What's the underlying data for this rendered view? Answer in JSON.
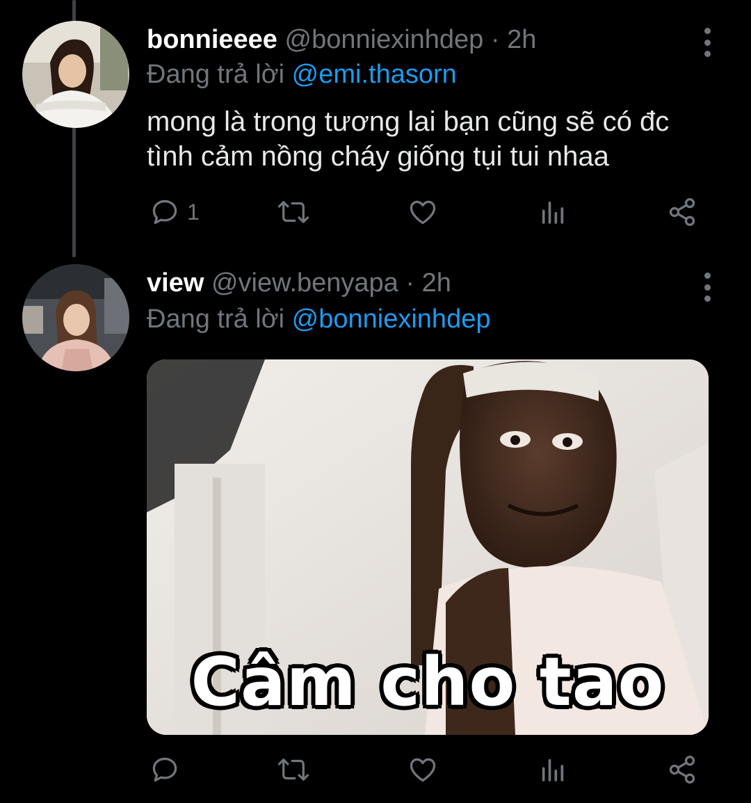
{
  "tweets": [
    {
      "display_name": "bonnieeee",
      "handle": "@bonniexinhdep",
      "separator": "·",
      "time": "2h",
      "reply_prefix": "Đang trả lời",
      "reply_to": "@emi.thasorn",
      "text_lines": [
        "mong là trong tương lai bạn cũng sẽ có đc",
        "tình cảm nồng cháy giống tụi tui nhaa"
      ],
      "reply_count": "1",
      "avatar_icon": "avatar-woman-white-top"
    },
    {
      "display_name": "view",
      "handle": "@view.benyapa",
      "separator": "·",
      "time": "2h",
      "reply_prefix": "Đang trả lời",
      "reply_to": "@bonniexinhdep",
      "media_caption": "Câm cho tao",
      "avatar_icon": "avatar-woman-pink-top"
    }
  ],
  "icons": {
    "reply": "reply-icon",
    "retweet": "retweet-icon",
    "like": "heart-icon",
    "analytics": "analytics-icon",
    "share": "share-icon",
    "more": "more-vertical-icon"
  },
  "colors": {
    "background": "#000000",
    "text": "#e7e9ea",
    "secondary": "#71767b",
    "mention": "#1d9bf0",
    "thread_line": "#3d4148"
  }
}
